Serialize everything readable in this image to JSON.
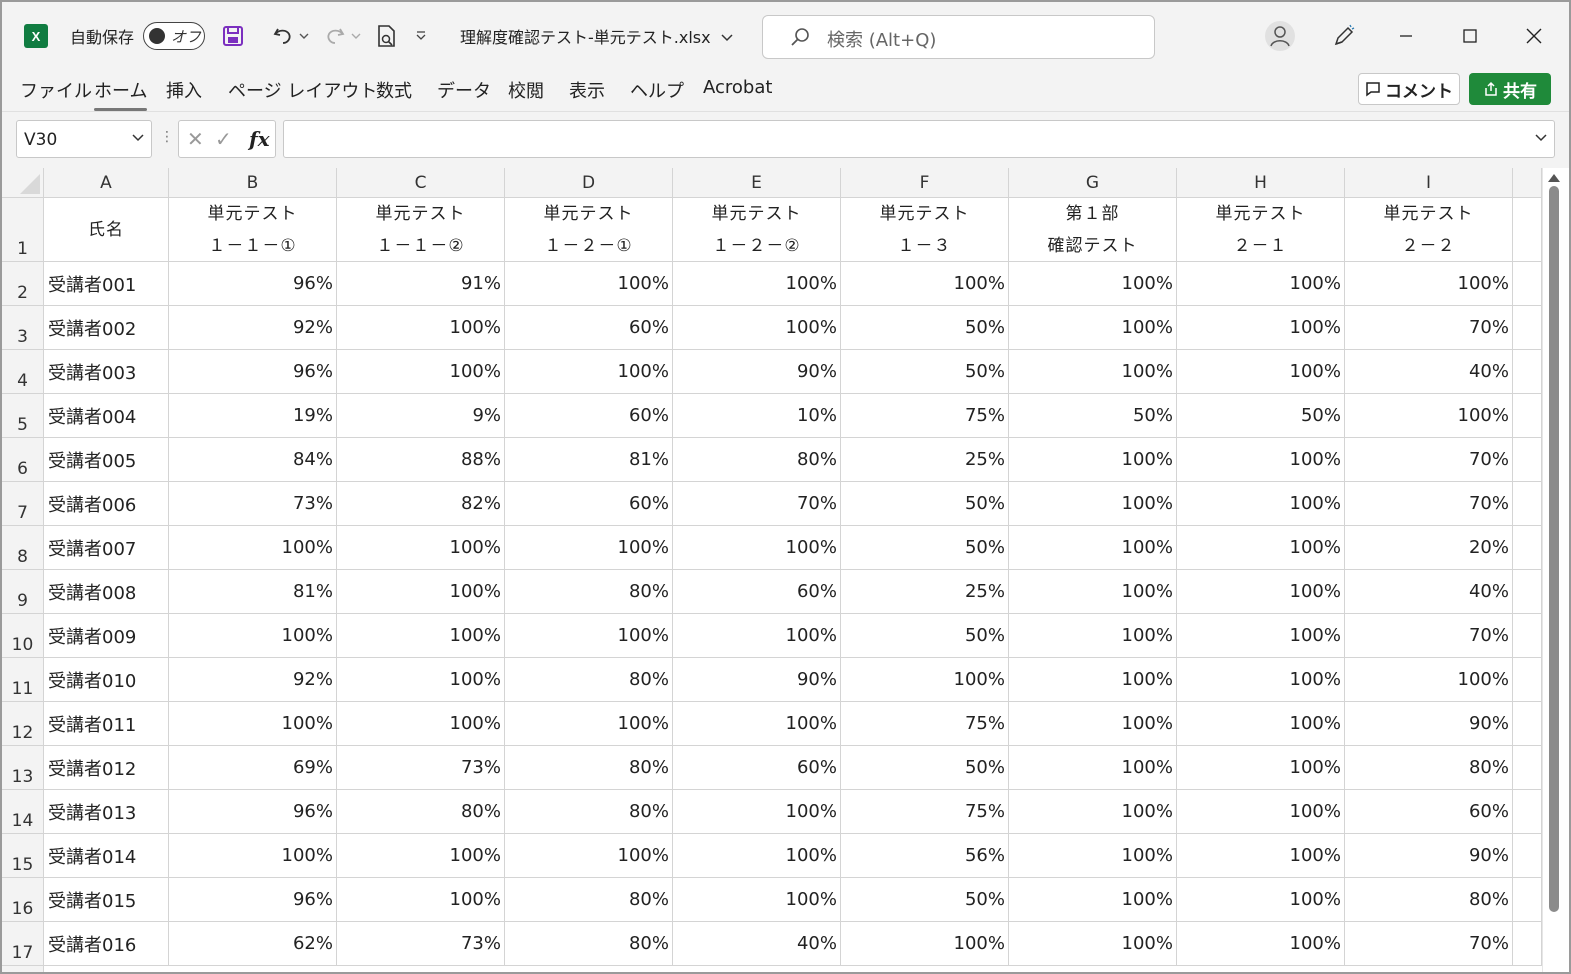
{
  "titlebar": {
    "app_icon_letter": "X",
    "autosave_label": "自動保存",
    "autosave_state": "オフ",
    "document_title": "理解度確認テスト-単元テスト.xlsx",
    "search_placeholder": "検索 (Alt+Q)"
  },
  "menu": {
    "items": [
      "ファイル",
      "ホーム",
      "挿入",
      "ページ レイアウト",
      "数式",
      "データ",
      "校閲",
      "表示",
      "ヘルプ",
      "Acrobat"
    ],
    "active": "ホーム",
    "comment_label": "コメント",
    "share_label": "共有"
  },
  "formula_bar": {
    "name_box": "V30",
    "fx_label": "fx",
    "formula_value": ""
  },
  "sheet": {
    "columns": [
      "A",
      "B",
      "C",
      "D",
      "E",
      "F",
      "G",
      "H",
      "I"
    ],
    "header_row": [
      [
        "氏名"
      ],
      [
        "単元テスト",
        "１－１－①"
      ],
      [
        "単元テスト",
        "１－１－②"
      ],
      [
        "単元テスト",
        "１－２－①"
      ],
      [
        "単元テスト",
        "１－２－②"
      ],
      [
        "単元テスト",
        "１－３"
      ],
      [
        "第１部",
        "確認テスト"
      ],
      [
        "単元テスト",
        "２－１"
      ],
      [
        "単元テスト",
        "２－２"
      ]
    ],
    "rows": [
      [
        "受講者001",
        "96%",
        "91%",
        "100%",
        "100%",
        "100%",
        "100%",
        "100%",
        "100%"
      ],
      [
        "受講者002",
        "92%",
        "100%",
        "60%",
        "100%",
        "50%",
        "100%",
        "100%",
        "70%"
      ],
      [
        "受講者003",
        "96%",
        "100%",
        "100%",
        "90%",
        "50%",
        "100%",
        "100%",
        "40%"
      ],
      [
        "受講者004",
        "19%",
        "9%",
        "60%",
        "10%",
        "75%",
        "50%",
        "50%",
        "100%"
      ],
      [
        "受講者005",
        "84%",
        "88%",
        "81%",
        "80%",
        "25%",
        "100%",
        "100%",
        "70%"
      ],
      [
        "受講者006",
        "73%",
        "82%",
        "60%",
        "70%",
        "50%",
        "100%",
        "100%",
        "70%"
      ],
      [
        "受講者007",
        "100%",
        "100%",
        "100%",
        "100%",
        "50%",
        "100%",
        "100%",
        "20%"
      ],
      [
        "受講者008",
        "81%",
        "100%",
        "80%",
        "60%",
        "25%",
        "100%",
        "100%",
        "40%"
      ],
      [
        "受講者009",
        "100%",
        "100%",
        "100%",
        "100%",
        "50%",
        "100%",
        "100%",
        "70%"
      ],
      [
        "受講者010",
        "92%",
        "100%",
        "80%",
        "90%",
        "100%",
        "100%",
        "100%",
        "100%"
      ],
      [
        "受講者011",
        "100%",
        "100%",
        "100%",
        "100%",
        "75%",
        "100%",
        "100%",
        "90%"
      ],
      [
        "受講者012",
        "69%",
        "73%",
        "80%",
        "60%",
        "50%",
        "100%",
        "100%",
        "80%"
      ],
      [
        "受講者013",
        "96%",
        "80%",
        "80%",
        "100%",
        "75%",
        "100%",
        "100%",
        "60%"
      ],
      [
        "受講者014",
        "100%",
        "100%",
        "100%",
        "100%",
        "56%",
        "100%",
        "100%",
        "90%"
      ],
      [
        "受講者015",
        "96%",
        "100%",
        "80%",
        "100%",
        "50%",
        "100%",
        "100%",
        "80%"
      ],
      [
        "受講者016",
        "62%",
        "73%",
        "80%",
        "40%",
        "100%",
        "100%",
        "100%",
        "70%"
      ]
    ]
  },
  "colors": {
    "share_button": "#1f8a3a",
    "app_icon": "#107c41",
    "save_icon": "#7b2fbf"
  }
}
